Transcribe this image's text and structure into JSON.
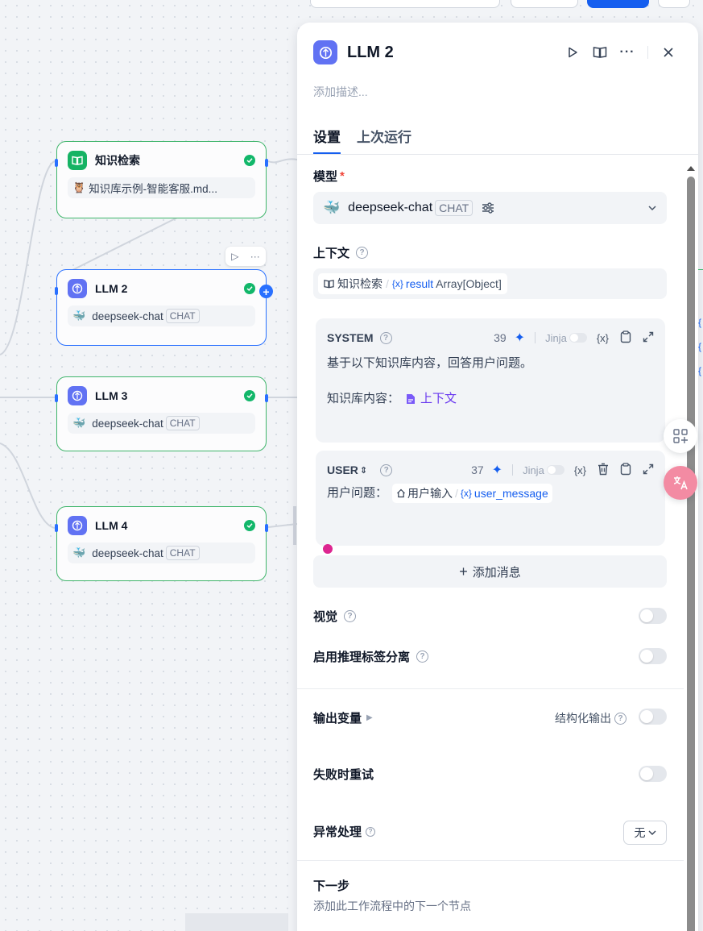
{
  "canvas": {
    "nodes": [
      {
        "title": "知识检索",
        "body": "知识库示例-智能客服.md..."
      },
      {
        "title": "LLM 2",
        "body": "deepseek-chat",
        "chip": "CHAT"
      },
      {
        "title": "LLM 3",
        "body": "deepseek-chat",
        "chip": "CHAT"
      },
      {
        "title": "LLM 4",
        "body": "deepseek-chat",
        "chip": "CHAT"
      }
    ]
  },
  "panel": {
    "title": "LLM 2",
    "description_placeholder": "添加描述...",
    "tabs": [
      "设置",
      "上次运行"
    ],
    "model_label": "模型",
    "required_mark": "*",
    "model_name": "deepseek-chat",
    "model_chip": "CHAT",
    "context_label": "上下文",
    "context_source": "知识检索",
    "context_separator": "/",
    "context_var": "result",
    "context_type": "Array[Object]",
    "system": {
      "role": "SYSTEM",
      "count": "39",
      "jinja": "Jinja",
      "line1": "基于以下知识库内容，回答用户问题。",
      "line2_prefix": "知识库内容：",
      "context_tag": "上下文"
    },
    "user": {
      "role": "USER",
      "count": "37",
      "jinja": "Jinja",
      "prefix": "用户问题：",
      "source": "用户输入",
      "separator": "/",
      "var": "user_message"
    },
    "add_message": "添加消息",
    "vision_label": "视觉",
    "reasoning_label": "启用推理标签分离",
    "output_label": "输出变量",
    "structured_output": "结构化输出",
    "retry_label": "失败时重试",
    "error_label": "异常处理",
    "error_value": "无",
    "next_label": "下一步",
    "next_desc": "添加此工作流程中的下一个节点"
  },
  "var_brace": "{x}"
}
